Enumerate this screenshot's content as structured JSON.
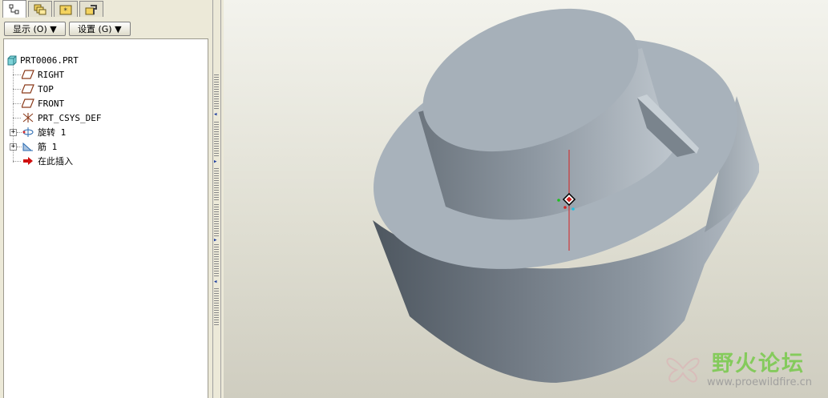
{
  "panel": {
    "tabs": [
      {
        "icon": "model-tree-icon"
      },
      {
        "icon": "layers-icon"
      },
      {
        "icon": "favorites-folder-icon"
      },
      {
        "icon": "tools-icon"
      }
    ],
    "show_button": "显示 (O) ▼",
    "settings_button": "设置 (G) ▼"
  },
  "tree": {
    "root": "PRT0006.PRT",
    "items": [
      {
        "label": "RIGHT",
        "icon": "datum-plane-icon"
      },
      {
        "label": "TOP",
        "icon": "datum-plane-icon"
      },
      {
        "label": "FRONT",
        "icon": "datum-plane-icon"
      },
      {
        "label": "PRT_CSYS_DEF",
        "icon": "coordinate-system-icon"
      },
      {
        "label": "旋转 1",
        "icon": "revolve-feature-icon",
        "expandable": true
      },
      {
        "label": "筋 1",
        "icon": "rib-feature-icon",
        "expandable": true
      },
      {
        "label": "在此插入",
        "icon": "insert-here-arrow-icon"
      }
    ]
  },
  "watermark": {
    "title": "野火论坛",
    "url": "www.proewildfire.cn"
  },
  "colors": {
    "viewport_bg": "#e0dfd3",
    "model_face": "#a5afb8",
    "axis_red": "#d42020"
  }
}
